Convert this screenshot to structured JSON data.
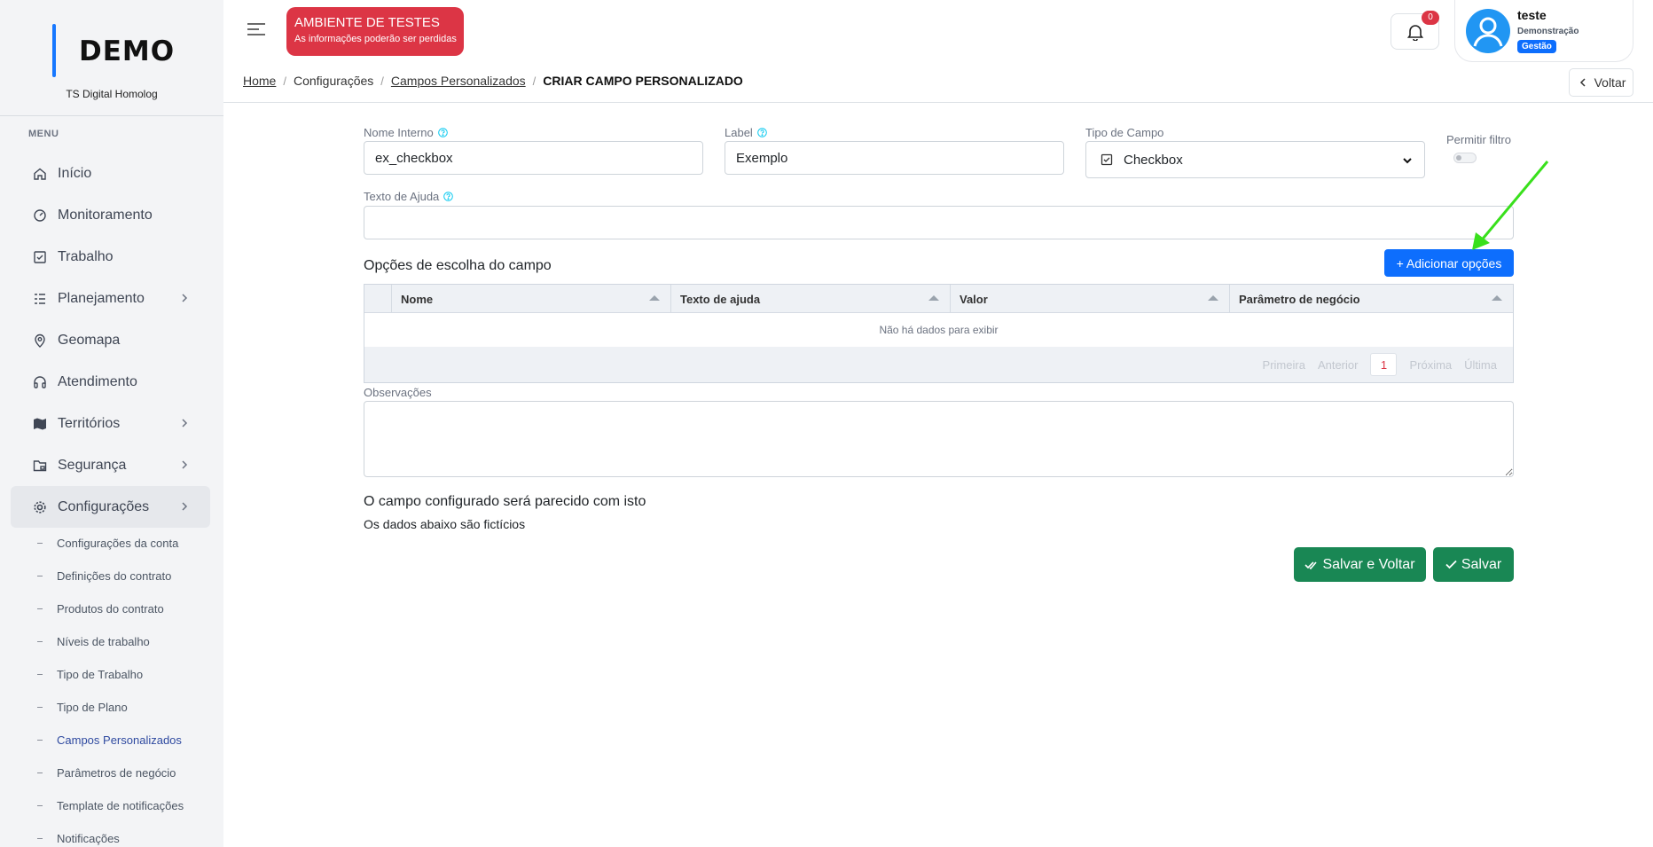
{
  "sidebar": {
    "brand": "DEMO",
    "subtitle": "TS Digital Homolog",
    "menu_title": "MENU",
    "items": [
      {
        "label": "Início"
      },
      {
        "label": "Monitoramento"
      },
      {
        "label": "Trabalho"
      },
      {
        "label": "Planejamento"
      },
      {
        "label": "Geomapa"
      },
      {
        "label": "Atendimento"
      },
      {
        "label": "Territórios"
      },
      {
        "label": "Segurança"
      },
      {
        "label": "Configurações"
      }
    ],
    "sub_items": [
      {
        "label": "Configurações da conta"
      },
      {
        "label": "Definições do contrato"
      },
      {
        "label": "Produtos do contrato"
      },
      {
        "label": "Níveis de trabalho"
      },
      {
        "label": "Tipo de Trabalho"
      },
      {
        "label": "Tipo de Plano"
      },
      {
        "label": "Campos Personalizados"
      },
      {
        "label": "Parâmetros de negócio"
      },
      {
        "label": "Template de notificações"
      },
      {
        "label": "Notificações"
      }
    ]
  },
  "header": {
    "env_title": "AMBIENTE DE TESTES",
    "env_subtitle": "As informações poderão ser perdidas",
    "notifications_count": "0",
    "user_name": "teste",
    "user_company": "Demonstração",
    "user_tag": "Gestão"
  },
  "breadcrumb": {
    "home": "Home",
    "config": "Configurações",
    "campos": "Campos Personalizados",
    "current": "CRIAR CAMPO PERSONALIZADO"
  },
  "back_label": "Voltar",
  "form": {
    "nome_interno_label": "Nome Interno",
    "nome_interno_value": "ex_checkbox",
    "label_label": "Label",
    "label_value": "Exemplo",
    "tipo_label": "Tipo de Campo",
    "tipo_value": "Checkbox",
    "filtro_label": "Permitir filtro",
    "ajuda_label": "Texto de Ajuda",
    "ajuda_value": ""
  },
  "options": {
    "title": "Opções de escolha do campo",
    "add_label": "+ Adicionar opções",
    "columns": [
      "Nome",
      "Texto de ajuda",
      "Valor",
      "Parâmetro de negócio"
    ],
    "empty_text": "Não há dados para exibir",
    "pager": {
      "first": "Primeira",
      "prev": "Anterior",
      "page": "1",
      "next": "Próxima",
      "last": "Última"
    }
  },
  "observacoes_label": "Observações",
  "preview": {
    "title": "O campo configurado será parecido com isto",
    "subtitle": "Os dados abaixo são fictícios"
  },
  "actions": {
    "save_back": "Salvar e Voltar",
    "save": "Salvar"
  }
}
